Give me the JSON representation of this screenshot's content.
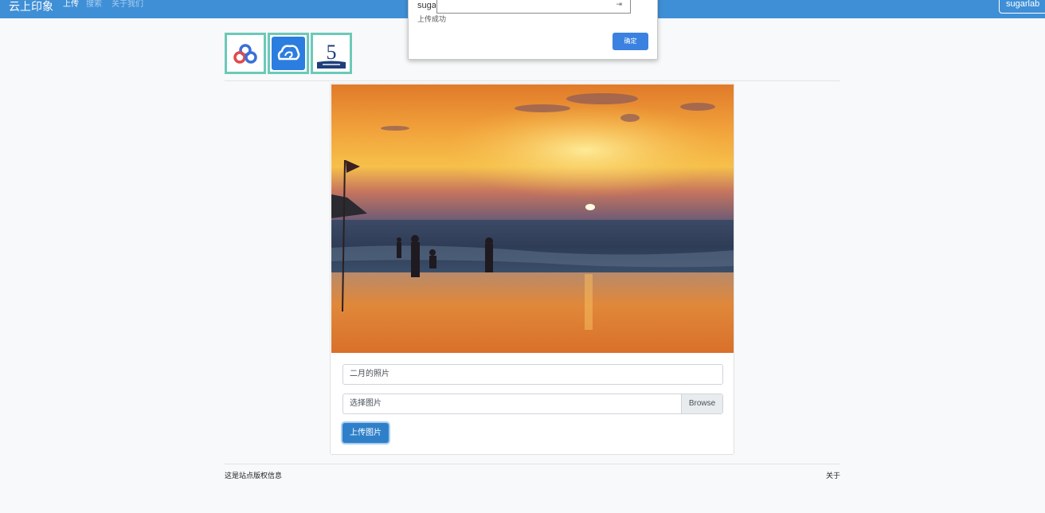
{
  "navbar": {
    "brand": "云上印象",
    "items": [
      {
        "label": "上传",
        "active": true
      },
      {
        "label": "搜索",
        "active": false
      },
      {
        "label": "关于我们",
        "active": false
      }
    ],
    "user_button": "sugarlab"
  },
  "dialog": {
    "input_prefix": "suga",
    "message": "上传成功",
    "ok_label": "确定"
  },
  "thumbnails": [
    {
      "icon": "baidu-cloud-icon"
    },
    {
      "icon": "cloud-icon"
    },
    {
      "icon": "number-5-icon"
    }
  ],
  "upload_card": {
    "image_alt": "sunset beach photo",
    "title_value": "二月的照片",
    "file_label": "选择图片",
    "browse_label": "Browse",
    "upload_button": "上传图片"
  },
  "footer": {
    "left_text": "这是站点版权信息",
    "right_text": "关于"
  },
  "colors": {
    "navbar_bg": "#3f8fd6",
    "primary": "#2f80c9",
    "thumb_border": "#6cc9b8"
  }
}
